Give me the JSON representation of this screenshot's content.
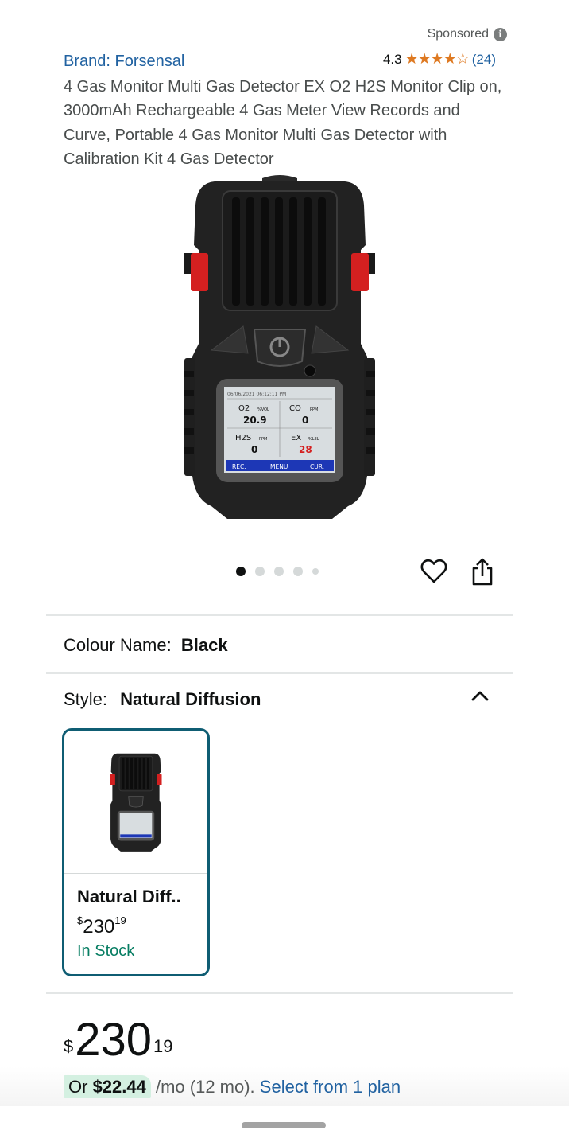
{
  "header": {
    "sponsored_label": "Sponsored",
    "brand_text": "Brand: Forsensal",
    "rating_value": "4.3",
    "rating_count": "(24)",
    "product_title": "4 Gas Monitor Multi Gas Detector EX O2 H2S Monitor Clip on, 3000mAh Rechargeable 4 Gas Meter View Records and Curve, Portable 4 Gas Monitor Multi Gas Detector with Calibration Kit 4 Gas Detector"
  },
  "device_screen": {
    "status_line": "06/06/2021  06:12:11 PM",
    "cells": [
      {
        "gas": "O2",
        "unit": "%VOL",
        "value": "20.9"
      },
      {
        "gas": "CO",
        "unit": "PPM",
        "value": "0"
      },
      {
        "gas": "H2S",
        "unit": "PPM",
        "value": "0"
      },
      {
        "gas": "EX",
        "unit": "%LEL",
        "value": "28"
      }
    ],
    "softkeys": [
      "REC.",
      "MENU",
      "CUR."
    ]
  },
  "carousel": {
    "image_count": 5,
    "active_index": 0
  },
  "variations": {
    "colour_label": "Colour Name:",
    "colour_value": "Black",
    "style_label": "Style:",
    "style_value": "Natural Diffusion"
  },
  "style_option": {
    "name": "Natural Diff..",
    "price_symbol": "$",
    "price_whole": "230",
    "price_fraction": "19",
    "stock": "In Stock"
  },
  "price": {
    "symbol": "$",
    "whole": "230",
    "fraction": "19"
  },
  "installment": {
    "prefix": "Or ",
    "amount": "$22.44",
    "suffix": " /mo (12 mo). ",
    "link": "Select from 1 plan"
  },
  "colors": {
    "link": "#2162a1",
    "star": "#de7921",
    "in_stock": "#067d62",
    "selected_border": "#0f5d73",
    "installment_highlight": "#d4f0e1"
  },
  "icons": [
    "info-icon",
    "star-icon",
    "heart-icon",
    "share-icon",
    "chevron-up-icon"
  ]
}
